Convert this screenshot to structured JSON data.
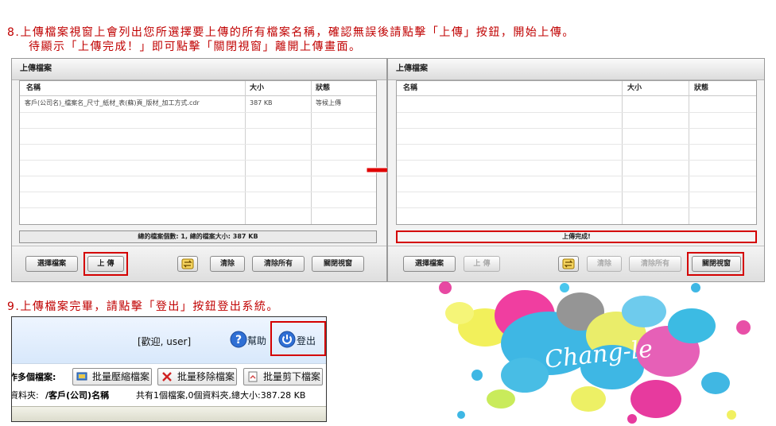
{
  "instructions": {
    "step8_line1": "8.上傳檔案視窗上會列出您所選擇要上傳的所有檔案名稱，確認無誤後請點擊「上傳」按鈕，開始上傳。",
    "step8_line2": "待顯示「上傳完成！」即可點擊「關閉視窗」離開上傳畫面。",
    "step9": "9.上傳檔案完畢，請點擊「登出」按鈕登出系統。"
  },
  "left_window": {
    "title": "上傳檔案",
    "columns": [
      "名稱",
      "大小",
      "狀態"
    ],
    "rows": [
      {
        "name": "客戶(公司名)_檔案名_尺寸_紙材_表(蘇)頁_版材_加工方式.cdr",
        "size": "387 KB",
        "status": "等候上傳"
      }
    ],
    "summary": "總的檔案個數: 1, 總的檔案大小: 387 KB",
    "buttons": {
      "select": "選擇檔案",
      "upload": "上 傳",
      "clear": "清除",
      "clear_all": "清除所有",
      "close": "關閉視窗"
    }
  },
  "right_window": {
    "title": "上傳檔案",
    "columns": [
      "名稱",
      "大小",
      "狀態"
    ],
    "status_message": "上傳完成!",
    "buttons": {
      "select": "選擇檔案",
      "upload": "上 傳",
      "clear": "清除",
      "clear_all": "清除所有",
      "close": "關閉視窗"
    }
  },
  "site_panel": {
    "welcome": "[歡迎, user]",
    "help": "幫助",
    "logout": "登出",
    "multi_label": "作多個檔案:",
    "batch_compress": "批量壓縮檔案",
    "batch_delete": "批量移除檔案",
    "batch_cut": "批量剪下檔案",
    "folder_label": "資料夾:",
    "folder_path": "/客戶(公司)名稱",
    "folder_stats": "共有1個檔案,0個資料夾,總大小:387.28 KB"
  },
  "logo_text": "Chang-le",
  "colors": {
    "highlight": "#d40000",
    "instruction": "#c00000",
    "panel_header": "#dbe9fb"
  }
}
